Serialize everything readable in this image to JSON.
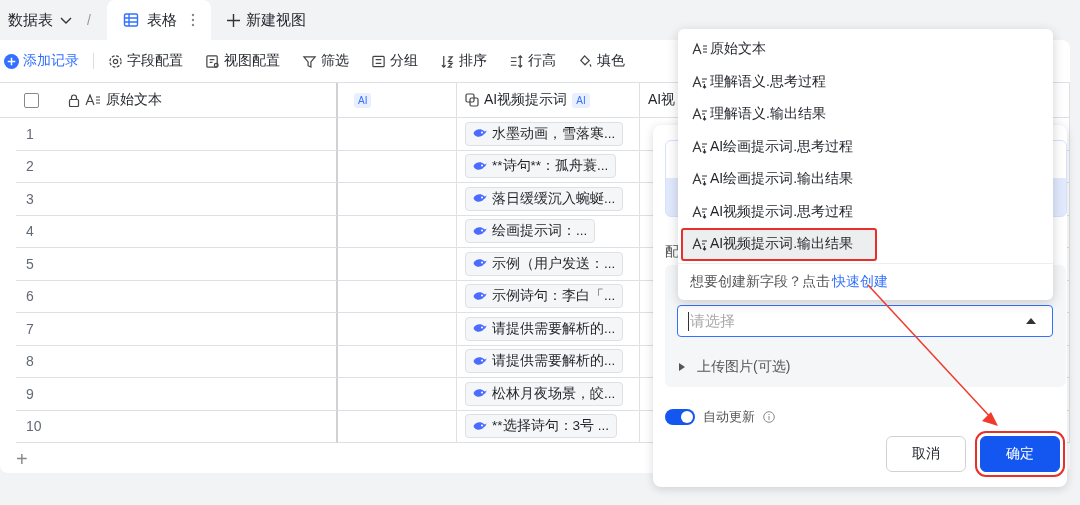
{
  "top_bar": {
    "table_switcher": "数据表",
    "separator": "/",
    "tabs": [
      {
        "label": "表格",
        "selected": true
      }
    ],
    "new_view": "新建视图"
  },
  "toolbar": {
    "add_record": "添加记录",
    "items": [
      {
        "label": "字段配置",
        "kind": "gear"
      },
      {
        "label": "视图配置",
        "kind": "doc"
      },
      {
        "label": "筛选",
        "kind": "filter"
      },
      {
        "label": "分组",
        "kind": "group"
      },
      {
        "label": "排序",
        "kind": "sort"
      },
      {
        "label": "行高",
        "kind": "height"
      },
      {
        "label": "填色",
        "kind": "fill"
      }
    ]
  },
  "grid": {
    "headers": [
      {
        "title": "原始文本",
        "locked": true
      },
      {
        "badge": "AI",
        "locked": false
      },
      {
        "title": "AI视频提示词",
        "badge": "AI",
        "locked": false
      },
      {
        "title": "AI视",
        "locked": false
      }
    ],
    "rows": [
      {
        "number": "1",
        "video_prompt": "水墨动画，雪落寒..."
      },
      {
        "number": "2",
        "video_prompt": "**诗句**：孤舟蓑..."
      },
      {
        "number": "3",
        "video_prompt": "落日缓缓沉入蜿蜒..."
      },
      {
        "number": "4",
        "video_prompt": "绘画提示词：..."
      },
      {
        "number": "5",
        "video_prompt": "示例（用户发送：..."
      },
      {
        "number": "6",
        "video_prompt": "示例诗句：李白「..."
      },
      {
        "number": "7",
        "video_prompt": "请提供需要解析的..."
      },
      {
        "number": "8",
        "video_prompt": "请提供需要解析的..."
      },
      {
        "number": "9",
        "video_prompt": "松林月夜场景，皎..."
      },
      {
        "number": "10",
        "video_prompt": "**选择诗句：3号 ..."
      }
    ],
    "add_row": "+"
  },
  "settings_panel": {
    "section_label": "配",
    "select": {
      "placeholder": "请选择",
      "open": true
    },
    "upload": {
      "label": "上传图片(可选)",
      "expanded": false
    },
    "auto_update": {
      "label": "自动更新",
      "on": true
    },
    "buttons": [
      {
        "label": "取消",
        "kind": "secondary",
        "annotated": false
      },
      {
        "label": "确定",
        "kind": "primary",
        "annotated": true
      }
    ]
  },
  "field_menu": {
    "items": [
      {
        "label": "原始文本",
        "kind": "text",
        "selected": false,
        "annotated": false
      },
      {
        "label": "理解语义.思考过程",
        "kind": "ai",
        "selected": false,
        "annotated": false
      },
      {
        "label": "理解语义.输出结果",
        "kind": "ai",
        "selected": false,
        "annotated": false
      },
      {
        "label": "AI绘画提示词.思考过程",
        "kind": "ai",
        "selected": false,
        "annotated": false
      },
      {
        "label": "AI绘画提示词.输出结果",
        "kind": "ai",
        "selected": false,
        "annotated": false
      },
      {
        "label": "AI视频提示词.思考过程",
        "kind": "ai",
        "selected": false,
        "annotated": false
      },
      {
        "label": "AI视频提示词.输出结果",
        "kind": "ai",
        "selected": true,
        "annotated": true
      }
    ],
    "hint": "想要创建新字段？点击",
    "link": "快速创建"
  },
  "annotation_arrow": true
}
